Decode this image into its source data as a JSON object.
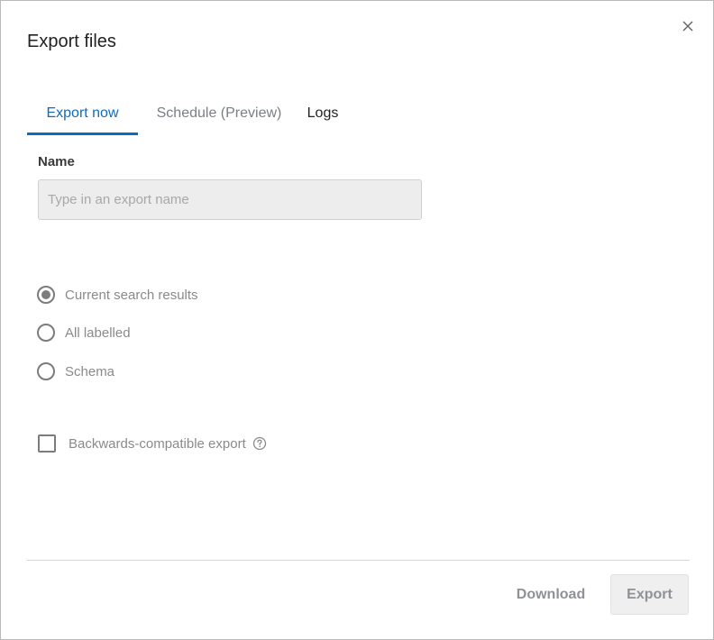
{
  "dialog": {
    "title": "Export files",
    "close_icon": "close-icon"
  },
  "tabs": [
    {
      "label": "Export now",
      "active": true
    },
    {
      "label": "Schedule (Preview)",
      "active": false
    },
    {
      "label": "Logs",
      "active": false
    }
  ],
  "form": {
    "name_label": "Name",
    "name_value": "",
    "name_placeholder": "Type in an export name",
    "export_scope": {
      "selected": "Current search results",
      "options": [
        "Current search results",
        "All labelled",
        "Schema"
      ]
    },
    "backwards_compatible": {
      "label": "Backwards-compatible export",
      "checked": false,
      "help_icon": "help-circle-icon"
    }
  },
  "footer": {
    "download_label": "Download",
    "export_label": "Export"
  },
  "colors": {
    "accent": "#0f6cbd",
    "disabled_text": "#8e9296",
    "input_bg": "#ededed"
  }
}
